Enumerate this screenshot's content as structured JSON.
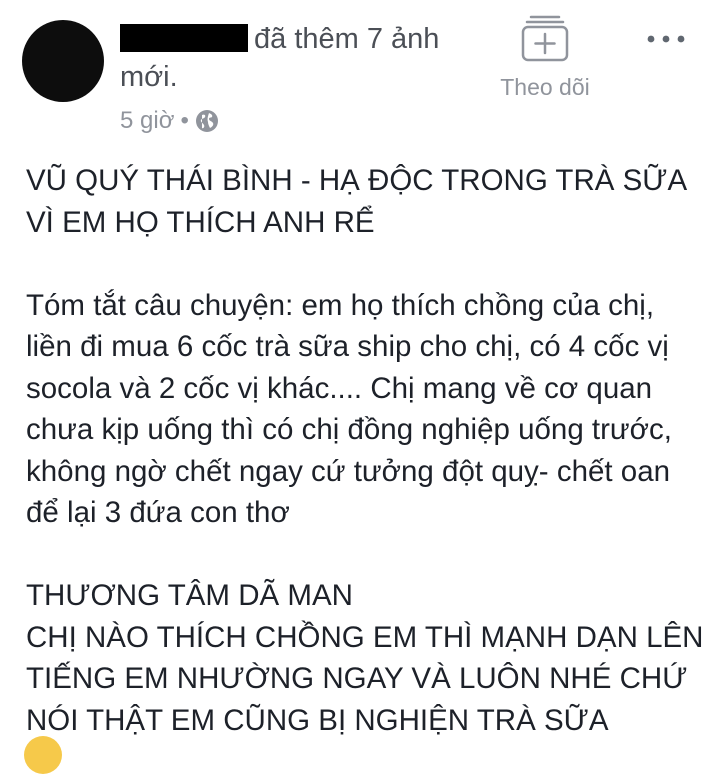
{
  "post": {
    "author_action": "đã thêm 7 ảnh mới.",
    "timestamp": "5 giờ",
    "separator": "•",
    "privacy_icon": "globe-icon",
    "follow_label": "Theo dõi",
    "follow_icon": "follow-plus-icon",
    "more_icon": "more-dots-icon",
    "body": "VŨ QUÝ THÁI BÌNH - HẠ ĐỘC TRONG TRÀ SỮA VÌ EM HỌ THÍCH ANH RỂ\n\nTóm tắt câu chuyện: em họ thích chồng của chị, liền đi mua 6 cốc trà sữa ship cho chị, có 4 cốc vị socola và 2 cốc vị khác.... Chị mang về cơ quan chưa kịp uống thì có chị đồng nghiệp uống trước, không ngờ chết ngay cứ tưởng đột quỵ- chết oan để lại 3 đứa con thơ\n\nTHƯƠNG TÂM DÃ MAN\nCHỊ NÀO THÍCH CHỒNG EM THÌ MẠNH DẠN LÊN TIẾNG EM NHƯỜNG NGAY VÀ LUÔN NHÉ CHỨ NÓI THẬT EM CŨNG BỊ NGHIỆN TRÀ SỮA"
  },
  "colors": {
    "text_primary": "#1d2129",
    "text_secondary": "#90949c",
    "background": "#ffffff"
  }
}
